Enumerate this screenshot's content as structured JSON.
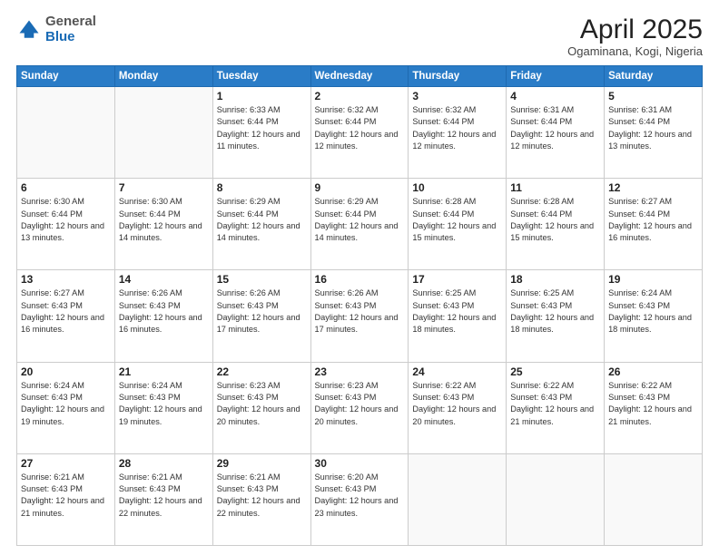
{
  "header": {
    "logo": {
      "general": "General",
      "blue": "Blue"
    },
    "title": "April 2025",
    "subtitle": "Ogaminana, Kogi, Nigeria"
  },
  "days_of_week": [
    "Sunday",
    "Monday",
    "Tuesday",
    "Wednesday",
    "Thursday",
    "Friday",
    "Saturday"
  ],
  "weeks": [
    [
      {
        "day": null
      },
      {
        "day": null
      },
      {
        "day": "1",
        "sunrise": "Sunrise: 6:33 AM",
        "sunset": "Sunset: 6:44 PM",
        "daylight": "Daylight: 12 hours and 11 minutes."
      },
      {
        "day": "2",
        "sunrise": "Sunrise: 6:32 AM",
        "sunset": "Sunset: 6:44 PM",
        "daylight": "Daylight: 12 hours and 12 minutes."
      },
      {
        "day": "3",
        "sunrise": "Sunrise: 6:32 AM",
        "sunset": "Sunset: 6:44 PM",
        "daylight": "Daylight: 12 hours and 12 minutes."
      },
      {
        "day": "4",
        "sunrise": "Sunrise: 6:31 AM",
        "sunset": "Sunset: 6:44 PM",
        "daylight": "Daylight: 12 hours and 12 minutes."
      },
      {
        "day": "5",
        "sunrise": "Sunrise: 6:31 AM",
        "sunset": "Sunset: 6:44 PM",
        "daylight": "Daylight: 12 hours and 13 minutes."
      }
    ],
    [
      {
        "day": "6",
        "sunrise": "Sunrise: 6:30 AM",
        "sunset": "Sunset: 6:44 PM",
        "daylight": "Daylight: 12 hours and 13 minutes."
      },
      {
        "day": "7",
        "sunrise": "Sunrise: 6:30 AM",
        "sunset": "Sunset: 6:44 PM",
        "daylight": "Daylight: 12 hours and 14 minutes."
      },
      {
        "day": "8",
        "sunrise": "Sunrise: 6:29 AM",
        "sunset": "Sunset: 6:44 PM",
        "daylight": "Daylight: 12 hours and 14 minutes."
      },
      {
        "day": "9",
        "sunrise": "Sunrise: 6:29 AM",
        "sunset": "Sunset: 6:44 PM",
        "daylight": "Daylight: 12 hours and 14 minutes."
      },
      {
        "day": "10",
        "sunrise": "Sunrise: 6:28 AM",
        "sunset": "Sunset: 6:44 PM",
        "daylight": "Daylight: 12 hours and 15 minutes."
      },
      {
        "day": "11",
        "sunrise": "Sunrise: 6:28 AM",
        "sunset": "Sunset: 6:44 PM",
        "daylight": "Daylight: 12 hours and 15 minutes."
      },
      {
        "day": "12",
        "sunrise": "Sunrise: 6:27 AM",
        "sunset": "Sunset: 6:44 PM",
        "daylight": "Daylight: 12 hours and 16 minutes."
      }
    ],
    [
      {
        "day": "13",
        "sunrise": "Sunrise: 6:27 AM",
        "sunset": "Sunset: 6:43 PM",
        "daylight": "Daylight: 12 hours and 16 minutes."
      },
      {
        "day": "14",
        "sunrise": "Sunrise: 6:26 AM",
        "sunset": "Sunset: 6:43 PM",
        "daylight": "Daylight: 12 hours and 16 minutes."
      },
      {
        "day": "15",
        "sunrise": "Sunrise: 6:26 AM",
        "sunset": "Sunset: 6:43 PM",
        "daylight": "Daylight: 12 hours and 17 minutes."
      },
      {
        "day": "16",
        "sunrise": "Sunrise: 6:26 AM",
        "sunset": "Sunset: 6:43 PM",
        "daylight": "Daylight: 12 hours and 17 minutes."
      },
      {
        "day": "17",
        "sunrise": "Sunrise: 6:25 AM",
        "sunset": "Sunset: 6:43 PM",
        "daylight": "Daylight: 12 hours and 18 minutes."
      },
      {
        "day": "18",
        "sunrise": "Sunrise: 6:25 AM",
        "sunset": "Sunset: 6:43 PM",
        "daylight": "Daylight: 12 hours and 18 minutes."
      },
      {
        "day": "19",
        "sunrise": "Sunrise: 6:24 AM",
        "sunset": "Sunset: 6:43 PM",
        "daylight": "Daylight: 12 hours and 18 minutes."
      }
    ],
    [
      {
        "day": "20",
        "sunrise": "Sunrise: 6:24 AM",
        "sunset": "Sunset: 6:43 PM",
        "daylight": "Daylight: 12 hours and 19 minutes."
      },
      {
        "day": "21",
        "sunrise": "Sunrise: 6:24 AM",
        "sunset": "Sunset: 6:43 PM",
        "daylight": "Daylight: 12 hours and 19 minutes."
      },
      {
        "day": "22",
        "sunrise": "Sunrise: 6:23 AM",
        "sunset": "Sunset: 6:43 PM",
        "daylight": "Daylight: 12 hours and 20 minutes."
      },
      {
        "day": "23",
        "sunrise": "Sunrise: 6:23 AM",
        "sunset": "Sunset: 6:43 PM",
        "daylight": "Daylight: 12 hours and 20 minutes."
      },
      {
        "day": "24",
        "sunrise": "Sunrise: 6:22 AM",
        "sunset": "Sunset: 6:43 PM",
        "daylight": "Daylight: 12 hours and 20 minutes."
      },
      {
        "day": "25",
        "sunrise": "Sunrise: 6:22 AM",
        "sunset": "Sunset: 6:43 PM",
        "daylight": "Daylight: 12 hours and 21 minutes."
      },
      {
        "day": "26",
        "sunrise": "Sunrise: 6:22 AM",
        "sunset": "Sunset: 6:43 PM",
        "daylight": "Daylight: 12 hours and 21 minutes."
      }
    ],
    [
      {
        "day": "27",
        "sunrise": "Sunrise: 6:21 AM",
        "sunset": "Sunset: 6:43 PM",
        "daylight": "Daylight: 12 hours and 21 minutes."
      },
      {
        "day": "28",
        "sunrise": "Sunrise: 6:21 AM",
        "sunset": "Sunset: 6:43 PM",
        "daylight": "Daylight: 12 hours and 22 minutes."
      },
      {
        "day": "29",
        "sunrise": "Sunrise: 6:21 AM",
        "sunset": "Sunset: 6:43 PM",
        "daylight": "Daylight: 12 hours and 22 minutes."
      },
      {
        "day": "30",
        "sunrise": "Sunrise: 6:20 AM",
        "sunset": "Sunset: 6:43 PM",
        "daylight": "Daylight: 12 hours and 23 minutes."
      },
      {
        "day": null
      },
      {
        "day": null
      },
      {
        "day": null
      }
    ]
  ]
}
